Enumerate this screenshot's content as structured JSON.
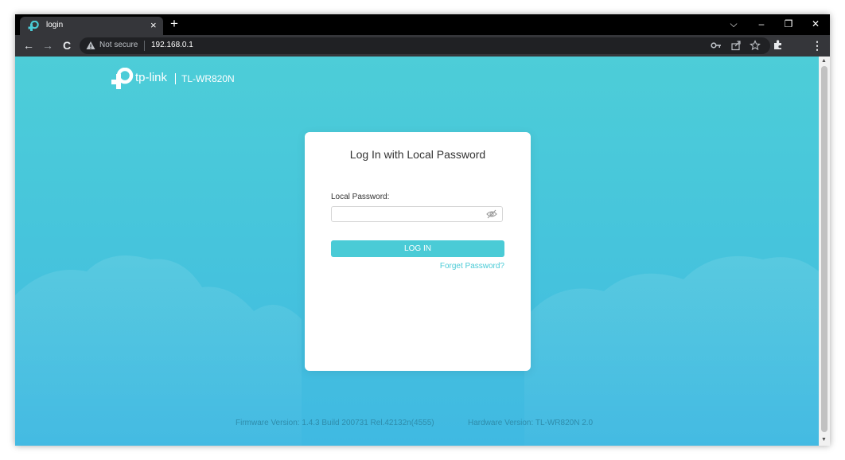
{
  "browser": {
    "tab": {
      "title": "login",
      "close": "×"
    },
    "new_tab": "+",
    "window_controls": {
      "tab_search": "⌵",
      "minimize": "–",
      "restore": "❐",
      "close": "✕"
    },
    "toolbar": {
      "back": "←",
      "forward": "→",
      "reload": "C",
      "security_label": "Not secure",
      "url": "192.168.0.1",
      "icons": [
        "key-icon",
        "share-icon",
        "star-icon",
        "extensions-icon",
        "menu-icon"
      ],
      "menu": "⋮"
    }
  },
  "page": {
    "brand": "tp-link",
    "model": "TL-WR820N",
    "login": {
      "title": "Log In with Local Password",
      "password_label": "Local Password:",
      "password_value": "",
      "button": "LOG IN",
      "forgot": "Forget Password?"
    },
    "footer": {
      "firmware": "Firmware Version: 1.4.3 Build 200731 Rel.42132n(4555)",
      "hardware": "Hardware Version: TL-WR820N 2.0"
    }
  },
  "colors": {
    "accent": "#4acbd6",
    "background_top": "#4dcdd8",
    "background_bottom": "#40b9e2",
    "footer_text": "#2e8cab"
  }
}
